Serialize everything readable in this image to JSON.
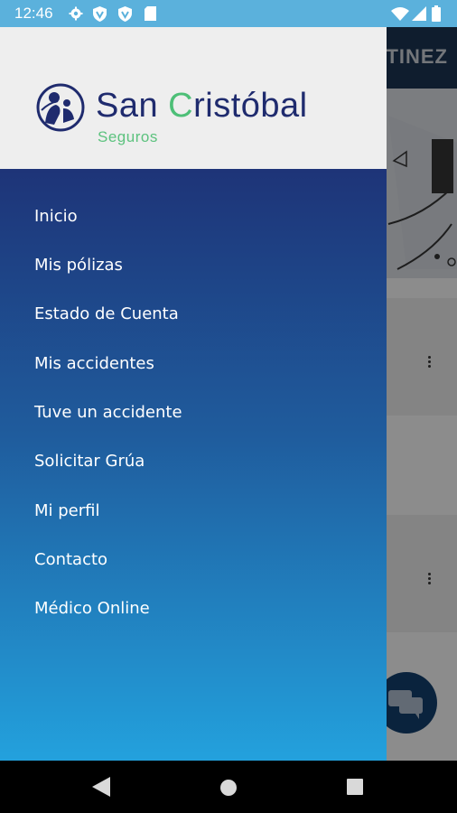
{
  "status_bar": {
    "time": "12:46",
    "icons": [
      "gear-icon",
      "shield-icon",
      "shield-icon",
      "sd-card-icon"
    ],
    "right_icons": [
      "wifi-icon",
      "signal-icon",
      "battery-icon"
    ]
  },
  "background_screen": {
    "header_text": "TINEZ"
  },
  "drawer": {
    "logo": {
      "brand": "San Cristóbal",
      "subtitle": "Seguros",
      "colors": {
        "brand": "#1f2b6e",
        "accent": "#4dbf77"
      }
    },
    "menu": [
      {
        "label": "Inicio"
      },
      {
        "label": "Mis pólizas"
      },
      {
        "label": "Estado de Cuenta"
      },
      {
        "label": "Mis accidentes"
      },
      {
        "label": "Tuve un accidente"
      },
      {
        "label": "Solicitar Grúa"
      },
      {
        "label": "Mi perfil"
      },
      {
        "label": "Contacto"
      },
      {
        "label": "Médico Online"
      }
    ],
    "gradient": [
      "#1e3478",
      "#1f5c9d",
      "#23a1dd"
    ]
  },
  "nav_bar": {
    "icons": [
      "back-icon",
      "home-icon",
      "recents-icon"
    ]
  }
}
